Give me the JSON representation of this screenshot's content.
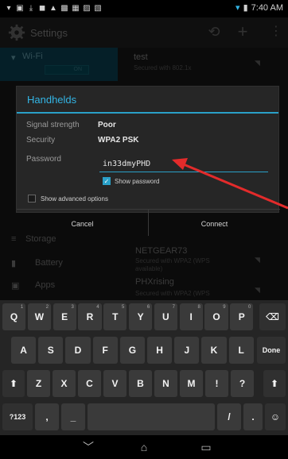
{
  "status_bar": {
    "time": "7:40 AM"
  },
  "action_bar": {
    "title": "Settings"
  },
  "background_list": {
    "wifi_label": "Wi-Fi",
    "wifi_toggle": "ON",
    "networks": [
      {
        "name": "test",
        "detail": "Secured with 802.1x"
      },
      {
        "name": "NETGEAR73",
        "detail": "Secured with WPA2 (WPS available)"
      },
      {
        "name": "PHXrising",
        "detail": "Secured with WPA2 (WPS"
      }
    ],
    "menu": [
      "Storage",
      "Battery",
      "Apps"
    ]
  },
  "dialog": {
    "title": "Handhelds",
    "signal_label": "Signal strength",
    "signal_value": "Poor",
    "security_label": "Security",
    "security_value": "WPA2 PSK",
    "password_label": "Password",
    "password_value": "in33dmyPHD",
    "show_password_label": "Show password",
    "show_password_checked": true,
    "advanced_label": "Show advanced options",
    "advanced_checked": false,
    "cancel_label": "Cancel",
    "connect_label": "Connect"
  },
  "keyboard": {
    "row1": [
      {
        "k": "Q",
        "h": "1"
      },
      {
        "k": "W",
        "h": "2"
      },
      {
        "k": "E",
        "h": "3"
      },
      {
        "k": "R",
        "h": "4"
      },
      {
        "k": "T",
        "h": "5"
      },
      {
        "k": "Y",
        "h": "6"
      },
      {
        "k": "U",
        "h": "7"
      },
      {
        "k": "I",
        "h": "8"
      },
      {
        "k": "O",
        "h": "9"
      },
      {
        "k": "P",
        "h": "0"
      }
    ],
    "row2": [
      "A",
      "S",
      "D",
      "F",
      "G",
      "H",
      "J",
      "K",
      "L"
    ],
    "row3": [
      "Z",
      "X",
      "C",
      "V",
      "B",
      "N",
      "M",
      "!",
      "?"
    ],
    "done_label": "Done",
    "symbols_label": "?123",
    "comma_label": ",",
    "dash_label": "_",
    "slash_label": "/",
    "period_label": "."
  },
  "colors": {
    "accent": "#33b5e5",
    "arrow": "#e32b2b"
  }
}
